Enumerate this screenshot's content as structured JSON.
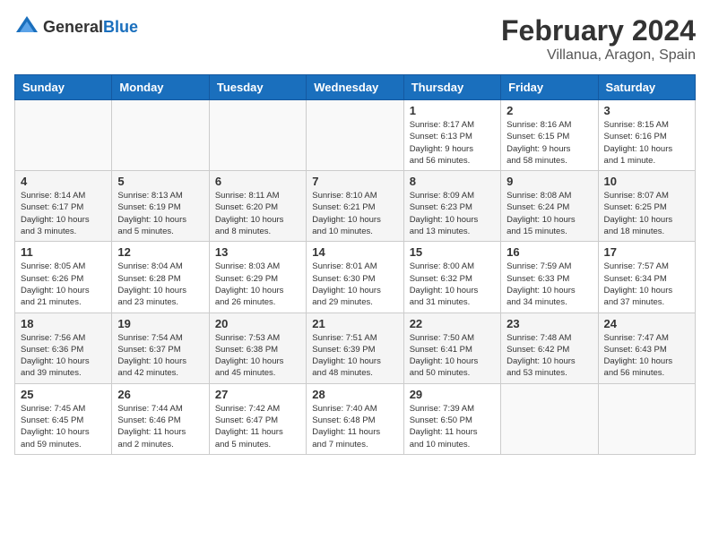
{
  "header": {
    "logo_general": "General",
    "logo_blue": "Blue",
    "month_title": "February 2024",
    "location": "Villanua, Aragon, Spain"
  },
  "days_of_week": [
    "Sunday",
    "Monday",
    "Tuesday",
    "Wednesday",
    "Thursday",
    "Friday",
    "Saturday"
  ],
  "weeks": [
    {
      "days": [
        {
          "num": "",
          "info": ""
        },
        {
          "num": "",
          "info": ""
        },
        {
          "num": "",
          "info": ""
        },
        {
          "num": "",
          "info": ""
        },
        {
          "num": "1",
          "info": "Sunrise: 8:17 AM\nSunset: 6:13 PM\nDaylight: 9 hours\nand 56 minutes."
        },
        {
          "num": "2",
          "info": "Sunrise: 8:16 AM\nSunset: 6:15 PM\nDaylight: 9 hours\nand 58 minutes."
        },
        {
          "num": "3",
          "info": "Sunrise: 8:15 AM\nSunset: 6:16 PM\nDaylight: 10 hours\nand 1 minute."
        }
      ]
    },
    {
      "days": [
        {
          "num": "4",
          "info": "Sunrise: 8:14 AM\nSunset: 6:17 PM\nDaylight: 10 hours\nand 3 minutes."
        },
        {
          "num": "5",
          "info": "Sunrise: 8:13 AM\nSunset: 6:19 PM\nDaylight: 10 hours\nand 5 minutes."
        },
        {
          "num": "6",
          "info": "Sunrise: 8:11 AM\nSunset: 6:20 PM\nDaylight: 10 hours\nand 8 minutes."
        },
        {
          "num": "7",
          "info": "Sunrise: 8:10 AM\nSunset: 6:21 PM\nDaylight: 10 hours\nand 10 minutes."
        },
        {
          "num": "8",
          "info": "Sunrise: 8:09 AM\nSunset: 6:23 PM\nDaylight: 10 hours\nand 13 minutes."
        },
        {
          "num": "9",
          "info": "Sunrise: 8:08 AM\nSunset: 6:24 PM\nDaylight: 10 hours\nand 15 minutes."
        },
        {
          "num": "10",
          "info": "Sunrise: 8:07 AM\nSunset: 6:25 PM\nDaylight: 10 hours\nand 18 minutes."
        }
      ]
    },
    {
      "days": [
        {
          "num": "11",
          "info": "Sunrise: 8:05 AM\nSunset: 6:26 PM\nDaylight: 10 hours\nand 21 minutes."
        },
        {
          "num": "12",
          "info": "Sunrise: 8:04 AM\nSunset: 6:28 PM\nDaylight: 10 hours\nand 23 minutes."
        },
        {
          "num": "13",
          "info": "Sunrise: 8:03 AM\nSunset: 6:29 PM\nDaylight: 10 hours\nand 26 minutes."
        },
        {
          "num": "14",
          "info": "Sunrise: 8:01 AM\nSunset: 6:30 PM\nDaylight: 10 hours\nand 29 minutes."
        },
        {
          "num": "15",
          "info": "Sunrise: 8:00 AM\nSunset: 6:32 PM\nDaylight: 10 hours\nand 31 minutes."
        },
        {
          "num": "16",
          "info": "Sunrise: 7:59 AM\nSunset: 6:33 PM\nDaylight: 10 hours\nand 34 minutes."
        },
        {
          "num": "17",
          "info": "Sunrise: 7:57 AM\nSunset: 6:34 PM\nDaylight: 10 hours\nand 37 minutes."
        }
      ]
    },
    {
      "days": [
        {
          "num": "18",
          "info": "Sunrise: 7:56 AM\nSunset: 6:36 PM\nDaylight: 10 hours\nand 39 minutes."
        },
        {
          "num": "19",
          "info": "Sunrise: 7:54 AM\nSunset: 6:37 PM\nDaylight: 10 hours\nand 42 minutes."
        },
        {
          "num": "20",
          "info": "Sunrise: 7:53 AM\nSunset: 6:38 PM\nDaylight: 10 hours\nand 45 minutes."
        },
        {
          "num": "21",
          "info": "Sunrise: 7:51 AM\nSunset: 6:39 PM\nDaylight: 10 hours\nand 48 minutes."
        },
        {
          "num": "22",
          "info": "Sunrise: 7:50 AM\nSunset: 6:41 PM\nDaylight: 10 hours\nand 50 minutes."
        },
        {
          "num": "23",
          "info": "Sunrise: 7:48 AM\nSunset: 6:42 PM\nDaylight: 10 hours\nand 53 minutes."
        },
        {
          "num": "24",
          "info": "Sunrise: 7:47 AM\nSunset: 6:43 PM\nDaylight: 10 hours\nand 56 minutes."
        }
      ]
    },
    {
      "days": [
        {
          "num": "25",
          "info": "Sunrise: 7:45 AM\nSunset: 6:45 PM\nDaylight: 10 hours\nand 59 minutes."
        },
        {
          "num": "26",
          "info": "Sunrise: 7:44 AM\nSunset: 6:46 PM\nDaylight: 11 hours\nand 2 minutes."
        },
        {
          "num": "27",
          "info": "Sunrise: 7:42 AM\nSunset: 6:47 PM\nDaylight: 11 hours\nand 5 minutes."
        },
        {
          "num": "28",
          "info": "Sunrise: 7:40 AM\nSunset: 6:48 PM\nDaylight: 11 hours\nand 7 minutes."
        },
        {
          "num": "29",
          "info": "Sunrise: 7:39 AM\nSunset: 6:50 PM\nDaylight: 11 hours\nand 10 minutes."
        },
        {
          "num": "",
          "info": ""
        },
        {
          "num": "",
          "info": ""
        }
      ]
    }
  ]
}
